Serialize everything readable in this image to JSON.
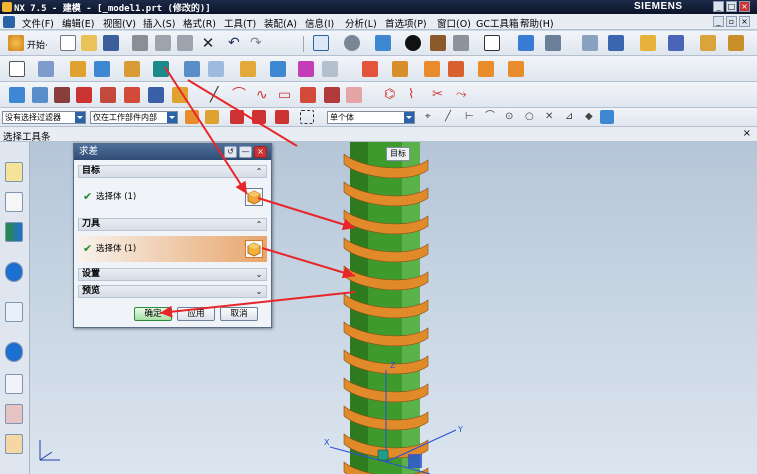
{
  "window": {
    "title": "NX 7.5 - 建模 - [_model1.prt (修改的)]",
    "brand": "SIEMENS",
    "controls": [
      "_",
      "□",
      "×"
    ]
  },
  "menubar": {
    "items": [
      "文件(F)",
      "编辑(E)",
      "视图(V)",
      "插入(S)",
      "格式(R)",
      "工具(T)",
      "装配(A)",
      "信息(I)",
      "分析(L)",
      "首选项(P)",
      "窗口(O)",
      "GC工具箱",
      "帮助(H)"
    ]
  },
  "toolbar1": {
    "start_label": "开始·"
  },
  "filterbar": {
    "type_filter": "没有选择过滤器",
    "scope_filter": "仅在工作部件内部",
    "body_filter": "单个体"
  },
  "selection_toolbar": {
    "label": "选择工具条"
  },
  "dialog": {
    "title": "求差",
    "target": {
      "header": "目标",
      "select_label": "选择体 (1)"
    },
    "tool": {
      "header": "刀具",
      "select_label": "选择体 (1)"
    },
    "settings_header": "设置",
    "preview_header": "预览",
    "buttons": {
      "ok": "确定",
      "apply": "应用",
      "cancel": "取消"
    }
  },
  "viewport": {
    "target_label": "目标",
    "axes": {
      "x": "X",
      "y": "Y",
      "z": "Z"
    }
  },
  "colors": {
    "helix": "#e08a2a",
    "cylinder": "#3f9a2c",
    "annotation_arrow": "#e8262a",
    "title_bar": "#0b1428"
  }
}
